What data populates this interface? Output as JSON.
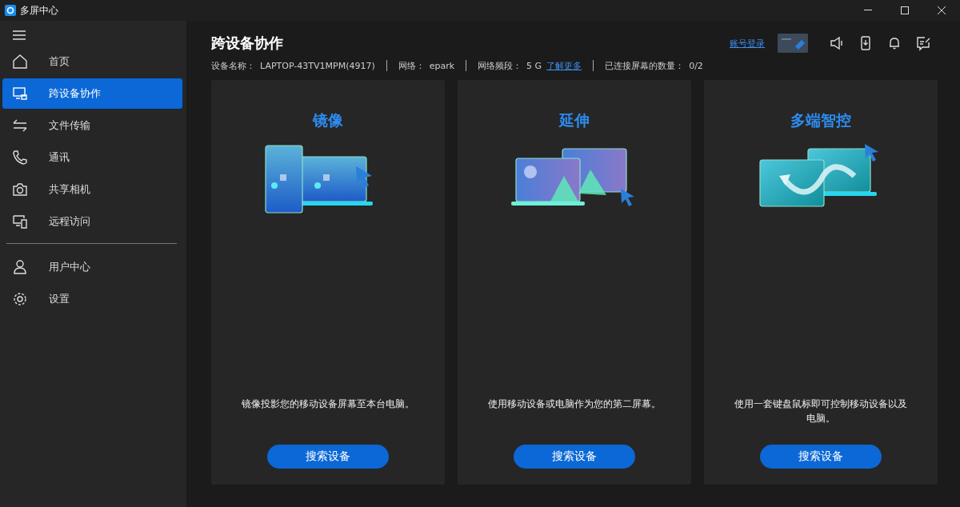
{
  "window": {
    "title": "多屏中心"
  },
  "sidebar": {
    "items": [
      {
        "label": "首页",
        "kind": "home",
        "selected": false
      },
      {
        "label": "跨设备协作",
        "kind": "screens",
        "selected": true
      },
      {
        "label": "文件传输",
        "kind": "transfer",
        "selected": false
      },
      {
        "label": "通讯",
        "kind": "phone",
        "selected": false
      },
      {
        "label": "共享相机",
        "kind": "camera",
        "selected": false
      },
      {
        "label": "远程访问",
        "kind": "remote",
        "selected": false
      }
    ],
    "bottom_items": [
      {
        "label": "用户中心",
        "kind": "user",
        "selected": false
      },
      {
        "label": "设置",
        "kind": "gear",
        "selected": false
      }
    ]
  },
  "header": {
    "title": "跨设备协作",
    "account_link": "账号登录",
    "info": [
      {
        "label": "设备名称：",
        "value": "LAPTOP-43TV1MPM(4917)"
      },
      {
        "label": "网络：",
        "value": "epark"
      },
      {
        "label": "网络频段：",
        "value": "5 G",
        "link": "了解更多"
      },
      {
        "label": "已连接屏幕的数量：",
        "value": "0/2"
      }
    ]
  },
  "cards": [
    {
      "kind": "mirror",
      "title": "镜像",
      "description": "镜像投影您的移动设备屏幕至本台电脑。",
      "button": "搜索设备"
    },
    {
      "kind": "extend",
      "title": "延伸",
      "description": "使用移动设备或电脑作为您的第二屏幕。",
      "button": "搜索设备"
    },
    {
      "kind": "control",
      "title": "多端智控",
      "description": "使用一套键盘鼠标即可控制移动设备以及电脑。",
      "button": "搜索设备"
    }
  ]
}
